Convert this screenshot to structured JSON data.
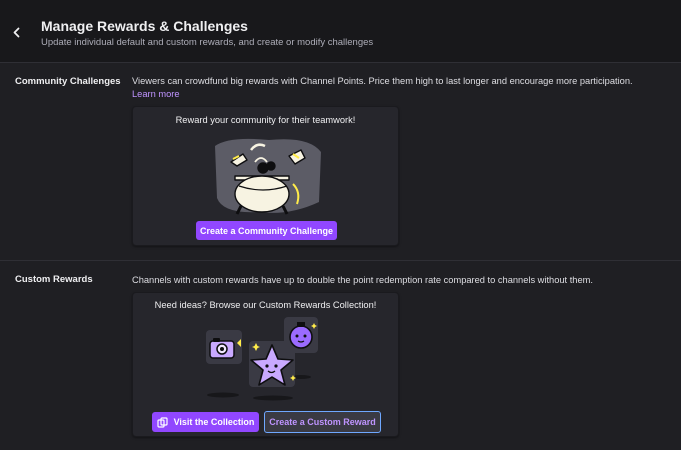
{
  "header": {
    "title": "Manage Rewards & Challenges",
    "subtitle": "Update individual default and custom rewards, and create or modify challenges",
    "back_icon": "chevron-left-icon"
  },
  "community_challenges": {
    "label": "Community Challenges",
    "description": "Viewers can crowdfund big rewards with Channel Points. Price them high to last longer and encourage more participation.",
    "link_text": "Learn more",
    "card_title": "Reward your community for their teamwork!",
    "button_label": "Create a Community Challenge",
    "illustration_icon": "cauldron-illustration"
  },
  "custom_rewards": {
    "label": "Custom Rewards",
    "description": "Channels with custom rewards have up to double the point redemption rate compared to channels without them.",
    "card_title": "Need ideas? Browse our Custom Rewards Collection!",
    "visit_button_label": "Visit the Collection",
    "create_button_label": "Create a Custom Reward",
    "illustration_icons": [
      "camera-icon",
      "star-icon",
      "potion-icon"
    ]
  },
  "colors": {
    "accent": "#9147ff",
    "link": "#bf94ff",
    "background": "#1f1f23",
    "card": "#26262c"
  }
}
